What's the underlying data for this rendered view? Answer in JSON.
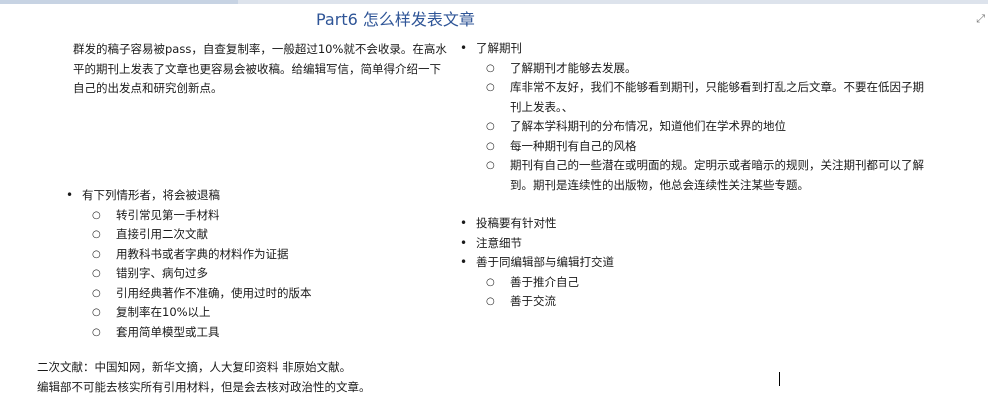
{
  "title": "Part6 怎么样发表文章",
  "intro": "群发的稿子容易被pass，自查复制率，一般超过10%就不会收录。在高水平的期刊上发表了文章也更容易会被收稿。给编辑写信，简单得介绍一下自己的出发点和研究创新点。",
  "left_list": {
    "heading": "有下列情形者，将会被退稿",
    "items": [
      "转引常见第一手材料",
      "直接引用二次文献",
      "用教科书或者字典的材料作为证据",
      "错别字、病句过多",
      "引用经典著作不准确，使用过时的版本",
      "复制率在10%以上",
      "套用简单模型或工具"
    ]
  },
  "right_top_list": {
    "heading": "了解期刊",
    "items": [
      "了解期刊才能够去发展。",
      "库非常不友好，我们不能够看到期刊，只能够看到打乱之后文章。不要在低因子期刊上发表。、",
      "了解本学科期刊的分布情况，知道他们在学术界的地位",
      "每一种期刊有自己的风格",
      "期刊有自己的一些潜在或明面的规。定明示或者暗示的规则，关注期刊都可以了解到。期刊是连续性的出版物，他总会连续性关注某些专题。"
    ]
  },
  "right_bottom_list": {
    "items": [
      "投稿要有针对性",
      "注意细节",
      "善于同编辑部与编辑打交道"
    ],
    "sub_items": [
      "善于推介自己",
      "善于交流"
    ]
  },
  "notes": {
    "line1": "二次文献：中国知网，新华文摘，人大复印资料 非原始文献。",
    "line2": "编辑部不可能去核实所有引用材料，但是会去核对政治性的文章。"
  },
  "icons": {
    "expand": "expand-icon"
  }
}
